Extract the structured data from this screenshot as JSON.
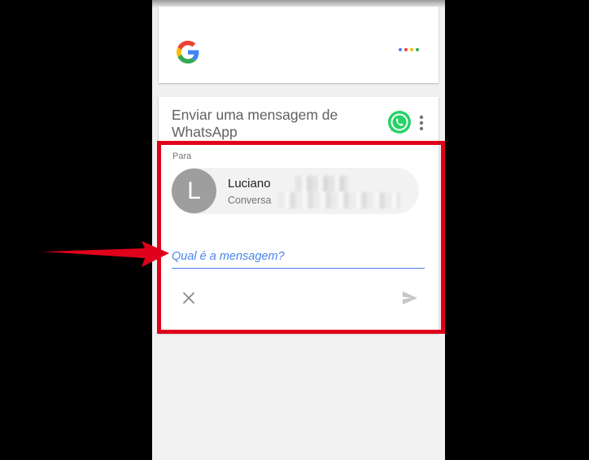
{
  "search_card": {
    "logo": "google-g-icon",
    "assistant_dots_colors": [
      "#4285F4",
      "#EA4335",
      "#FBBC05",
      "#34A853"
    ]
  },
  "message_card": {
    "title": "Enviar uma mensagem de WhatsApp",
    "app_icon": "whatsapp-icon",
    "menu_icon": "more-vert-icon",
    "to_label": "Para",
    "contact": {
      "initial": "L",
      "name": "Luciano",
      "detail": "Conversa"
    },
    "message_placeholder": "Qual é a mensagem?",
    "cancel_icon": "close-icon",
    "send_icon": "send-icon"
  },
  "annotation": {
    "highlight_color": "#e0001b",
    "arrow": "arrow-right-icon"
  }
}
